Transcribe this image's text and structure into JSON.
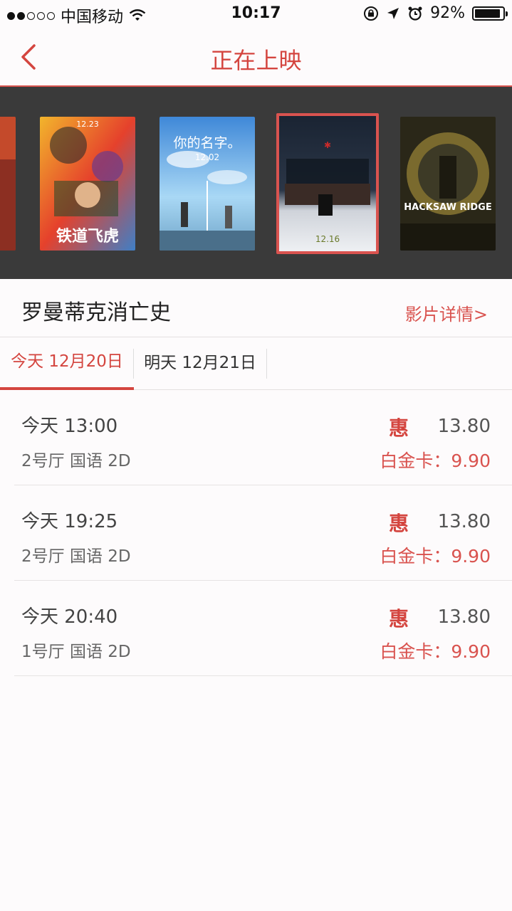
{
  "status": {
    "carrier": "中国移动",
    "time": "10:17",
    "battery": "92%",
    "battery_fraction": 0.92
  },
  "nav": {
    "title": "正在上映"
  },
  "posters": [
    {
      "name": "poster-partial",
      "text": "",
      "colors": [
        "#b23b2a",
        "#2f6b3a"
      ]
    },
    {
      "name": "poster-railroad-tigers",
      "text": "铁道飞虎",
      "date": "12.23",
      "colors": [
        "#e5412c",
        "#3f7fc6"
      ]
    },
    {
      "name": "poster-your-name",
      "text": "你的名字。",
      "date": "12.02",
      "colors": [
        "#5da8e6",
        "#d7eefb"
      ]
    },
    {
      "name": "poster-selected-movie",
      "text": "",
      "date": "12.16",
      "colors": [
        "#1f2a3a",
        "#e8e8ea"
      ]
    },
    {
      "name": "poster-hacksaw-ridge",
      "text": "HACKSAW RIDGE",
      "colors": [
        "#2d2a1c",
        "#8a7a3a"
      ]
    }
  ],
  "movie": {
    "title": "罗曼蒂克消亡史",
    "detail_link": "影片详情>"
  },
  "tabs": [
    {
      "label": "今天 12月20日",
      "active": true
    },
    {
      "label": "明天 12月21日",
      "active": false
    }
  ],
  "showtimes": [
    {
      "time": "今天 13:00",
      "hall": "2号厅 国语 2D",
      "promo": "惠",
      "price": "13.80",
      "vip": "白金卡：9.90"
    },
    {
      "time": "今天 19:25",
      "hall": "2号厅 国语 2D",
      "promo": "惠",
      "price": "13.80",
      "vip": "白金卡：9.90"
    },
    {
      "time": "今天 20:40",
      "hall": "1号厅 国语 2D",
      "promo": "惠",
      "price": "13.80",
      "vip": "白金卡：9.90"
    }
  ],
  "colors": {
    "accent": "#d4453f",
    "strip_bg": "#3a3a3a"
  }
}
